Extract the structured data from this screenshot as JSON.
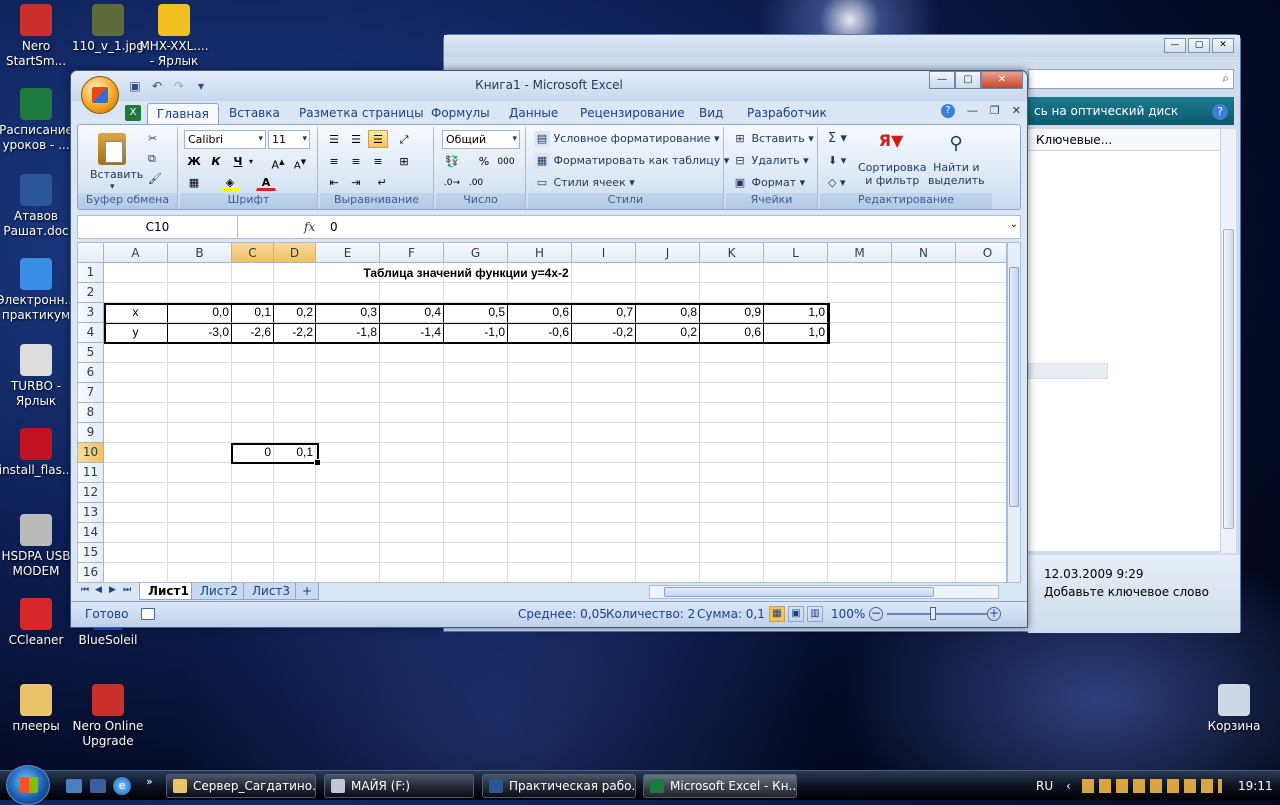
{
  "desktop": {
    "icons": [
      {
        "label": "Nero\nStartSm...",
        "color": "#c9302c"
      },
      {
        "label": "110_v_1.jpg",
        "color": "#5c6b3a"
      },
      {
        "label": "MHX-XXL....\n- Ярлык",
        "color": "#f0c020"
      },
      {
        "label": "Расписание\nуроков - ...",
        "color": "#1e7a3c"
      },
      {
        "label": "Атавов\nРашат.doc",
        "color": "#2b5797"
      },
      {
        "label": "Электронн...\nпрактикум",
        "color": "#3a8ee6"
      },
      {
        "label": "TURBO -\nЯрлык",
        "color": "#dddddd"
      },
      {
        "label": "install_flas...",
        "color": "#c1121f"
      },
      {
        "label": "HSDPA USB\nMODEM",
        "color": "#bbbbbb"
      },
      {
        "label": "CCleaner",
        "color": "#d62828"
      },
      {
        "label": "BlueSoleil",
        "color": "#1d4ed8"
      },
      {
        "label": "плееры",
        "color": "#e9c46a"
      },
      {
        "label": "Nero Online\nUpgrade",
        "color": "#c9302c"
      },
      {
        "label": "Корзина",
        "color": "#cfd8e3"
      }
    ]
  },
  "bg_window": {
    "panel_title": "сь на оптический диск",
    "column": "Ключевые...",
    "date": "12.03.2009 9:29",
    "keyword_prompt": "Добавьте ключевое слово"
  },
  "excel": {
    "title": "Книга1 - Microsoft Excel",
    "tabs": [
      "Главная",
      "Вставка",
      "Разметка страницы",
      "Формулы",
      "Данные",
      "Рецензирование",
      "Вид",
      "Разработчик"
    ],
    "ribbon": {
      "clipboard": {
        "name": "Буфер обмена",
        "paste": "Вставить"
      },
      "font": {
        "name": "Шрифт",
        "font_family": "Calibri",
        "font_size": "11",
        "bold": "Ж",
        "italic": "К",
        "underline": "Ч"
      },
      "alignment": {
        "name": "Выравнивание"
      },
      "number": {
        "name": "Число",
        "format": "Общий",
        "percent": "%",
        "thousands": "000"
      },
      "styles": {
        "name": "Стили",
        "conditional": "Условное форматирование",
        "as_table": "Форматировать как таблицу",
        "cell_styles": "Стили ячеек"
      },
      "cells": {
        "name": "Ячейки",
        "insert": "Вставить",
        "delete": "Удалить",
        "format": "Формат"
      },
      "editing": {
        "name": "Редактирование",
        "sort": "Сортировка\nи фильтр",
        "find": "Найти и\nвыделить"
      }
    },
    "name_box": "C10",
    "fx_label": "fx",
    "formula_value": "0",
    "columns": [
      "A",
      "B",
      "C",
      "D",
      "E",
      "F",
      "G",
      "H",
      "I",
      "J",
      "K",
      "L",
      "M",
      "N",
      "O"
    ],
    "selected_columns": [
      "C",
      "D"
    ],
    "rows": [
      "1",
      "2",
      "3",
      "4",
      "5",
      "6",
      "7",
      "8",
      "9",
      "10",
      "11",
      "12",
      "13",
      "14",
      "15",
      "16"
    ],
    "selected_row": "10",
    "sheet_title": "Таблица значений функции y=4x-2",
    "table": {
      "x_label": "x",
      "y_label": "y",
      "x": [
        "0,0",
        "0,1",
        "0,2",
        "0,3",
        "0,4",
        "0,5",
        "0,6",
        "0,7",
        "0,8",
        "0,9",
        "1,0"
      ],
      "y": [
        "-3,0",
        "-2,6",
        "-2,2",
        "-1,8",
        "-1,4",
        "-1,0",
        "-0,6",
        "-0,2",
        "0,2",
        "0,6",
        "1,0"
      ]
    },
    "row10": {
      "C": "0",
      "D": "0,1"
    },
    "sheets": [
      "Лист1",
      "Лист2",
      "Лист3"
    ],
    "status": {
      "ready": "Готово",
      "average": "Среднее: 0,05",
      "count": "Количество: 2",
      "sum": "Сумма: 0,1",
      "zoom": "100%"
    }
  },
  "taskbar": {
    "items": [
      "Сервер_Сагдатино...",
      "МАЙЯ (F:)",
      "Практическая рабо...",
      "Microsoft Excel - Кн..."
    ],
    "lang": "RU",
    "clock": "19:11"
  }
}
